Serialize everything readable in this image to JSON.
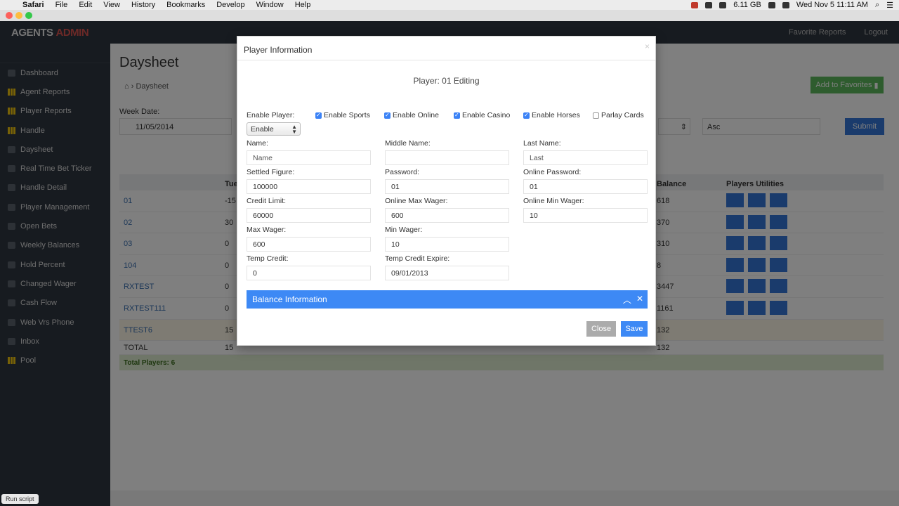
{
  "os_menubar": {
    "app": "Safari",
    "items": [
      "File",
      "Edit",
      "View",
      "History",
      "Bookmarks",
      "Develop",
      "Window",
      "Help"
    ],
    "memory": "6.11 GB",
    "clock": "Wed Nov 5  11:11 AM"
  },
  "app": {
    "brand_main": "AGENTS",
    "brand_accent": "ADMIN",
    "favorite_reports": "Favorite Reports",
    "logout": "Logout"
  },
  "sidebar": {
    "items": [
      {
        "label": "Dashboard",
        "icon": "dashboard-icon"
      },
      {
        "label": "Agent Reports",
        "icon": "grid-icon"
      },
      {
        "label": "Player Reports",
        "icon": "grid-icon"
      },
      {
        "label": "Handle",
        "icon": "grid-icon"
      },
      {
        "label": "Daysheet",
        "icon": "calendar-icon"
      },
      {
        "label": "Real Time Bet Ticker",
        "icon": "ticker-icon"
      },
      {
        "label": "Handle Detail",
        "icon": "list-icon"
      },
      {
        "label": "Player Management",
        "icon": "users-icon"
      },
      {
        "label": "Open Bets",
        "icon": "bets-icon"
      },
      {
        "label": "Weekly Balances",
        "icon": "balance-icon"
      },
      {
        "label": "Hold Percent",
        "icon": "percent-icon"
      },
      {
        "label": "Changed Wager",
        "icon": "edit-icon"
      },
      {
        "label": "Cash Flow",
        "icon": "cash-icon"
      },
      {
        "label": "Web Vrs Phone",
        "icon": "phone-icon"
      },
      {
        "label": "Inbox",
        "icon": "inbox-icon"
      },
      {
        "label": "Pool",
        "icon": "grid-icon"
      }
    ]
  },
  "page": {
    "title": "Daysheet",
    "breadcrumb": "Daysheet",
    "add_favorites": "Add to Favorites",
    "week_date_label": "Week Date:",
    "week_date_value": "11/05/2014",
    "sort_value": "Asc",
    "submit": "Submit",
    "col_tue": "Tue",
    "col_balance": "Balance",
    "col_utilities": "Players Utilities",
    "rows": [
      {
        "name": "01",
        "tue": "-15",
        "bal": "618"
      },
      {
        "name": "02",
        "tue": "30",
        "bal": "370"
      },
      {
        "name": "03",
        "tue": "0",
        "bal": "310"
      },
      {
        "name": "104",
        "tue": "0",
        "bal": "8"
      },
      {
        "name": "RXTEST",
        "tue": "0",
        "bal": "3447"
      },
      {
        "name": "RXTEST111",
        "tue": "0",
        "bal": "1161"
      },
      {
        "name": "TTEST6",
        "tue": "15",
        "bal": "132"
      },
      {
        "name": "TOTAL",
        "tue": "15",
        "bal": "132"
      }
    ],
    "total_players": "Total Players: 6"
  },
  "modal": {
    "title": "Player Information",
    "editing": "Player: 01 Editing",
    "enable_player_label": "Enable Player:",
    "enable_player_value": "Enable",
    "checkboxes": [
      {
        "label": "Enable Sports",
        "checked": true
      },
      {
        "label": "Enable Online",
        "checked": true
      },
      {
        "label": "Enable Casino",
        "checked": true
      },
      {
        "label": "Enable Horses",
        "checked": true
      },
      {
        "label": "Parlay Cards",
        "checked": false
      }
    ],
    "fields": {
      "name_label": "Name:",
      "name_placeholder": "Name",
      "middle_label": "Middle Name:",
      "middle_value": "",
      "last_label": "Last Name:",
      "last_placeholder": "Last",
      "settled_label": "Settled Figure:",
      "settled_value": "100000",
      "password_label": "Password:",
      "password_value": "01",
      "online_password_label": "Online Password:",
      "online_password_value": "01",
      "credit_label": "Credit Limit:",
      "credit_value": "60000",
      "online_max_label": "Online Max Wager:",
      "online_max_value": "600",
      "online_min_label": "Online Min Wager:",
      "online_min_value": "10",
      "max_label": "Max Wager:",
      "max_value": "600",
      "min_label": "Min Wager:",
      "min_value": "10",
      "temp_credit_label": "Temp Credit:",
      "temp_credit_value": "0",
      "temp_expire_label": "Temp Credit Expire:",
      "temp_expire_value": "09/01/2013"
    },
    "balance_panel": "Balance Information",
    "close": "Close",
    "save": "Save"
  },
  "status_bar": "Run script",
  "colors": {
    "primary": "#3d89f5",
    "success": "#5cb85c",
    "sidebar": "#2f3640",
    "brand_accent": "#d9534f"
  }
}
